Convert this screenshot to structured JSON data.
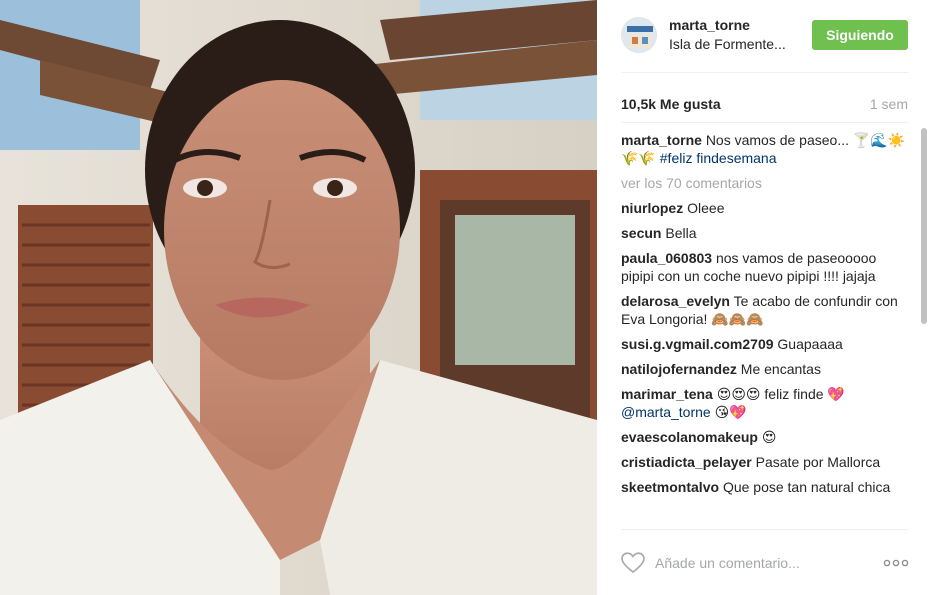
{
  "post": {
    "username": "marta_torne",
    "location": "Isla de Formente...",
    "follow_label": "Siguiendo",
    "likes": "10,5k Me gusta",
    "time": "1 sem"
  },
  "caption": {
    "username": "marta_torne",
    "text": "Nos vamos de paseo... 🍸🌊☀️🌾🌾",
    "hashtag": "#feliz findesemana"
  },
  "view_all": "ver los 70 comentarios",
  "comments": [
    {
      "user": "niurlopez",
      "text": "Oleee"
    },
    {
      "user": "secun",
      "text": "Bella"
    },
    {
      "user": "paula_060803",
      "text": "nos vamos de paseooooo pipipi con un coche nuevo pipipi !!!! jajaja"
    },
    {
      "user": "delarosa_evelyn",
      "text": "Te acabo de confundir con Eva Longoria! 🙈🙈🙈"
    },
    {
      "user": "susi.g.vgmail.com2709",
      "text": "Guapaaaa"
    },
    {
      "user": "natilojofernandez",
      "text": "Me encantas"
    },
    {
      "user": "marimar_tena",
      "text": "😍😍😍 feliz finde 💖",
      "mention": "@marta_torne",
      "after_mention": "😘💖"
    },
    {
      "user": "evaescolanomakeup",
      "text": "😍"
    },
    {
      "user": "cristiadicta_pelayer",
      "text": "Pasate por Mallorca"
    },
    {
      "user": "skeetmontalvo",
      "text": "Que pose tan natural chica"
    }
  ],
  "footer": {
    "placeholder": "Añade un comentario..."
  },
  "colors": {
    "follow_button": "#70c050",
    "link": "#003569",
    "muted": "#a5a7aa"
  },
  "icons": {
    "like": "heart-outline-icon",
    "more": "more-options-icon"
  }
}
